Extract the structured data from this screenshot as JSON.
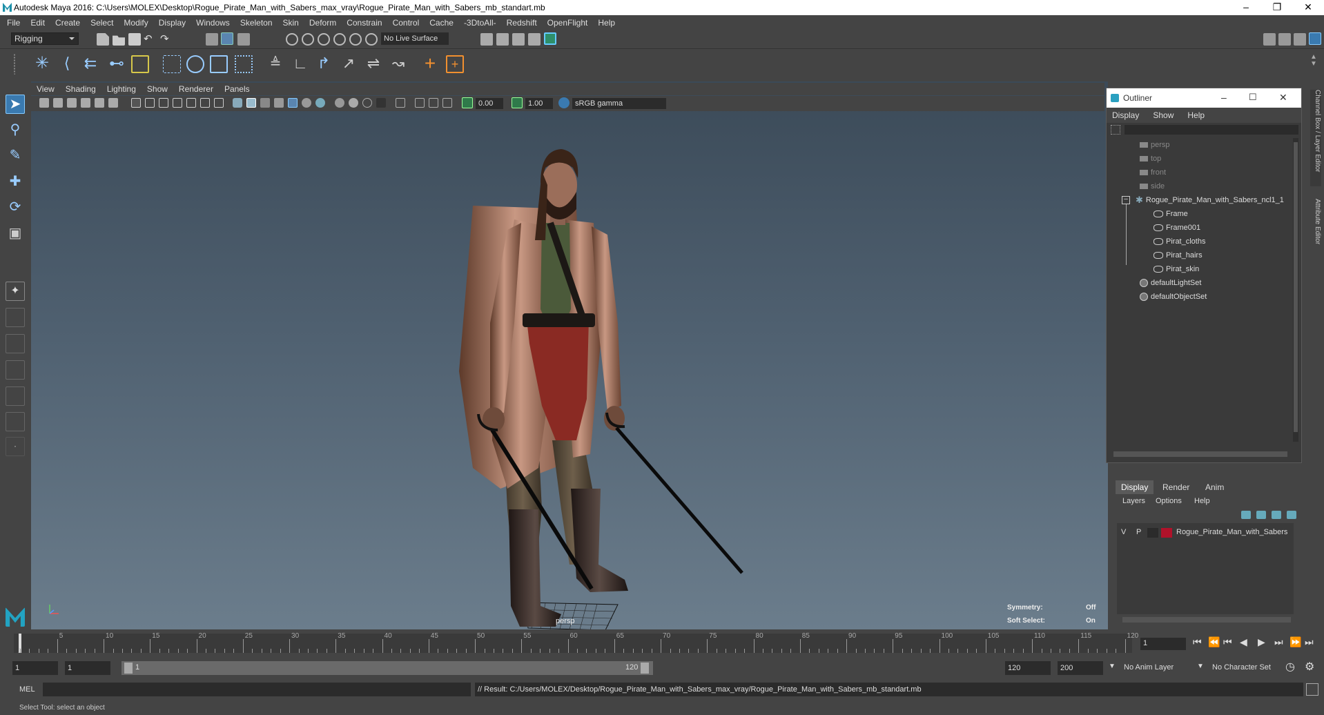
{
  "window": {
    "title": "Autodesk Maya 2016: C:\\Users\\MOLEX\\Desktop\\Rogue_Pirate_Man_with_Sabers_max_vray\\Rogue_Pirate_Man_with_Sabers_mb_standart.mb"
  },
  "menubar": [
    "File",
    "Edit",
    "Create",
    "Select",
    "Modify",
    "Display",
    "Windows",
    "Skeleton",
    "Skin",
    "Deform",
    "Constrain",
    "Control",
    "Cache",
    "-3DtoAll-",
    "Redshift",
    "OpenFlight",
    "Help"
  ],
  "statusline": {
    "mode": "Rigging",
    "live_surface": "No Live Surface"
  },
  "viewport": {
    "menu": [
      "View",
      "Shading",
      "Lighting",
      "Show",
      "Renderer",
      "Panels"
    ],
    "exposure": "0.00",
    "gamma": "1.00",
    "color_space": "sRGB gamma",
    "camera_label": "persp",
    "symmetry_label": "Symmetry:",
    "symmetry_value": "Off",
    "softselect_label": "Soft Select:",
    "softselect_value": "On"
  },
  "outliner": {
    "title": "Outliner",
    "menu": [
      "Display",
      "Show",
      "Help"
    ],
    "items": [
      {
        "label": "persp",
        "dim": true
      },
      {
        "label": "top",
        "dim": true
      },
      {
        "label": "front",
        "dim": true
      },
      {
        "label": "side",
        "dim": true
      },
      {
        "label": "Rogue_Pirate_Man_with_Sabers_ncl1_1",
        "dim": false
      },
      {
        "label": "Frame",
        "dim": false
      },
      {
        "label": "Frame001",
        "dim": false
      },
      {
        "label": "Pirat_cloths",
        "dim": false
      },
      {
        "label": "Pirat_hairs",
        "dim": false
      },
      {
        "label": "Pirat_skin",
        "dim": false
      },
      {
        "label": "defaultLightSet",
        "dim": false
      },
      {
        "label": "defaultObjectSet",
        "dim": false
      }
    ]
  },
  "layers": {
    "tabs": [
      "Display",
      "Render",
      "Anim"
    ],
    "menu": [
      "Layers",
      "Options",
      "Help"
    ],
    "row": {
      "v": "V",
      "p": "P",
      "name": "Rogue_Pirate_Man_with_Sabers",
      "color": "#b0122a"
    }
  },
  "timeline": {
    "ticks": [
      "5",
      "10",
      "15",
      "20",
      "25",
      "30",
      "35",
      "40",
      "45",
      "50",
      "55",
      "60",
      "65",
      "70",
      "75",
      "80",
      "85",
      "90",
      "95",
      "100",
      "105",
      "110",
      "115",
      "120"
    ],
    "first": "1",
    "current_frame": "1"
  },
  "range": {
    "start": "1",
    "start2": "1",
    "slider_start": "1",
    "slider_end": "120",
    "end": "120",
    "end2": "200",
    "anim_layer": "No Anim Layer",
    "char_set": "No Character Set"
  },
  "cmdline": {
    "lang": "MEL",
    "result": "// Result: C:/Users/MOLEX/Desktop/Rogue_Pirate_Man_with_Sabers_max_vray/Rogue_Pirate_Man_with_Sabers_mb_standart.mb"
  },
  "helpline": "Select Tool: select an object",
  "side_tabs": [
    "Channel Box / Layer Editor",
    "Attribute Editor"
  ]
}
